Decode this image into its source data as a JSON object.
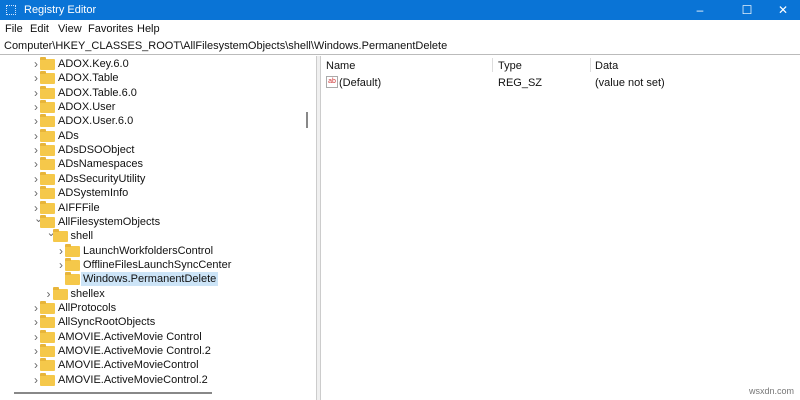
{
  "window": {
    "title": "Registry Editor",
    "minimize": "–",
    "maximize": "☐",
    "close": "✕"
  },
  "menu": [
    "File",
    "Edit",
    "View",
    "Favorites",
    "Help"
  ],
  "address": "Computer\\HKEY_CLASSES_ROOT\\AllFilesystemObjects\\shell\\Windows.PermanentDelete",
  "tree": [
    {
      "label": "ADOX.Key.6.0",
      "level": 0,
      "state": "collapsed"
    },
    {
      "label": "ADOX.Table",
      "level": 0,
      "state": "collapsed"
    },
    {
      "label": "ADOX.Table.6.0",
      "level": 0,
      "state": "collapsed"
    },
    {
      "label": "ADOX.User",
      "level": 0,
      "state": "collapsed"
    },
    {
      "label": "ADOX.User.6.0",
      "level": 0,
      "state": "collapsed"
    },
    {
      "label": "ADs",
      "level": 0,
      "state": "collapsed"
    },
    {
      "label": "ADsDSOObject",
      "level": 0,
      "state": "collapsed"
    },
    {
      "label": "ADsNamespaces",
      "level": 0,
      "state": "collapsed"
    },
    {
      "label": "ADsSecurityUtility",
      "level": 0,
      "state": "collapsed"
    },
    {
      "label": "ADSystemInfo",
      "level": 0,
      "state": "collapsed"
    },
    {
      "label": "AIFFFile",
      "level": 0,
      "state": "collapsed"
    },
    {
      "label": "AllFilesystemObjects",
      "level": 0,
      "state": "expanded"
    },
    {
      "label": "shell",
      "level": 1,
      "state": "expanded"
    },
    {
      "label": "LaunchWorkfoldersControl",
      "level": 2,
      "state": "collapsed"
    },
    {
      "label": "OfflineFilesLaunchSyncCenter",
      "level": 2,
      "state": "collapsed"
    },
    {
      "label": "Windows.PermanentDelete",
      "level": 2,
      "state": "leaf",
      "selected": true
    },
    {
      "label": "shellex",
      "level": 1,
      "state": "collapsed"
    },
    {
      "label": "AllProtocols",
      "level": 0,
      "state": "collapsed"
    },
    {
      "label": "AllSyncRootObjects",
      "level": 0,
      "state": "collapsed"
    },
    {
      "label": "AMOVIE.ActiveMovie Control",
      "level": 0,
      "state": "collapsed"
    },
    {
      "label": "AMOVIE.ActiveMovie Control.2",
      "level": 0,
      "state": "collapsed"
    },
    {
      "label": "AMOVIE.ActiveMovieControl",
      "level": 0,
      "state": "collapsed"
    },
    {
      "label": "AMOVIE.ActiveMovieControl.2",
      "level": 0,
      "state": "collapsed"
    }
  ],
  "values": {
    "columns": {
      "name": "Name",
      "type": "Type",
      "data": "Data"
    },
    "rows": [
      {
        "name": "(Default)",
        "type": "REG_SZ",
        "data": "(value not set)",
        "icon": "ab"
      }
    ]
  },
  "watermark": "wsxdn.com"
}
